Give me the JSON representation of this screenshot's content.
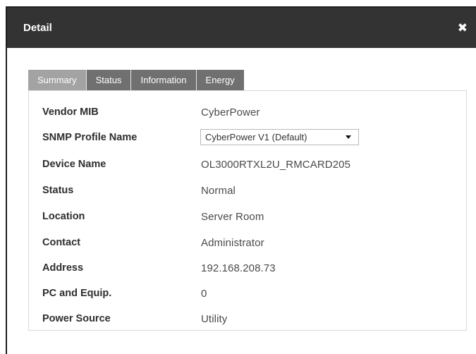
{
  "dialog": {
    "title": "Detail",
    "close_glyph": "✖"
  },
  "tabs": [
    {
      "label": "Summary",
      "active": true
    },
    {
      "label": "Status",
      "active": false
    },
    {
      "label": "Information",
      "active": false
    },
    {
      "label": "Energy",
      "active": false
    }
  ],
  "summary": {
    "vendor_mib": {
      "label": "Vendor MIB",
      "value": "CyberPower"
    },
    "snmp_profile": {
      "label": "SNMP Profile Name",
      "value": "CyberPower V1 (Default)"
    },
    "device_name": {
      "label": "Device Name",
      "value": "OL3000RTXL2U_RMCARD205"
    },
    "status": {
      "label": "Status",
      "value": "Normal"
    },
    "location": {
      "label": "Location",
      "value": "Server Room"
    },
    "contact": {
      "label": "Contact",
      "value": "Administrator"
    },
    "address": {
      "label": "Address",
      "value": "192.168.208.73"
    },
    "pc_equip": {
      "label": "PC and Equip.",
      "value": "0"
    },
    "power_source": {
      "label": "Power Source",
      "value": "Utility"
    }
  }
}
